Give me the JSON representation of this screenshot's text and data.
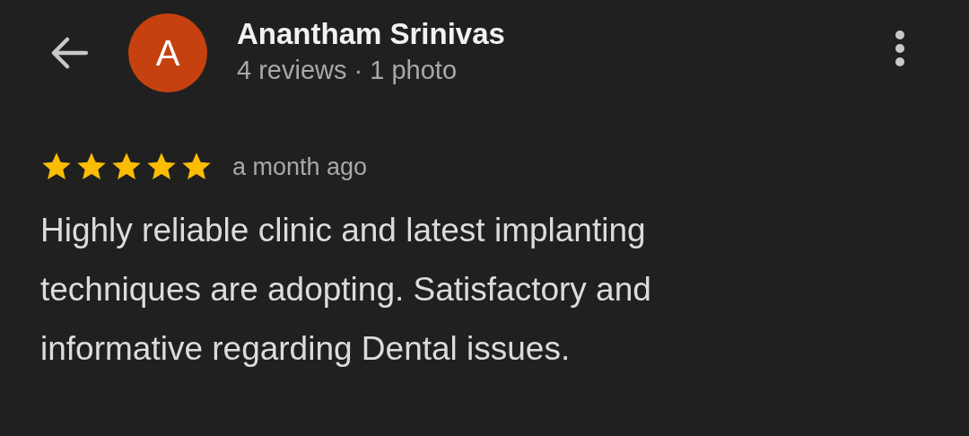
{
  "header": {
    "avatar_letter": "A",
    "name": "Anantham Srinivas",
    "subtitle": "4 reviews · 1 photo"
  },
  "review": {
    "stars": 5,
    "time": "a month ago",
    "text": "Highly reliable clinic and latest implanting techniques are adopting. Satisfactory and informative regarding Dental issues."
  }
}
